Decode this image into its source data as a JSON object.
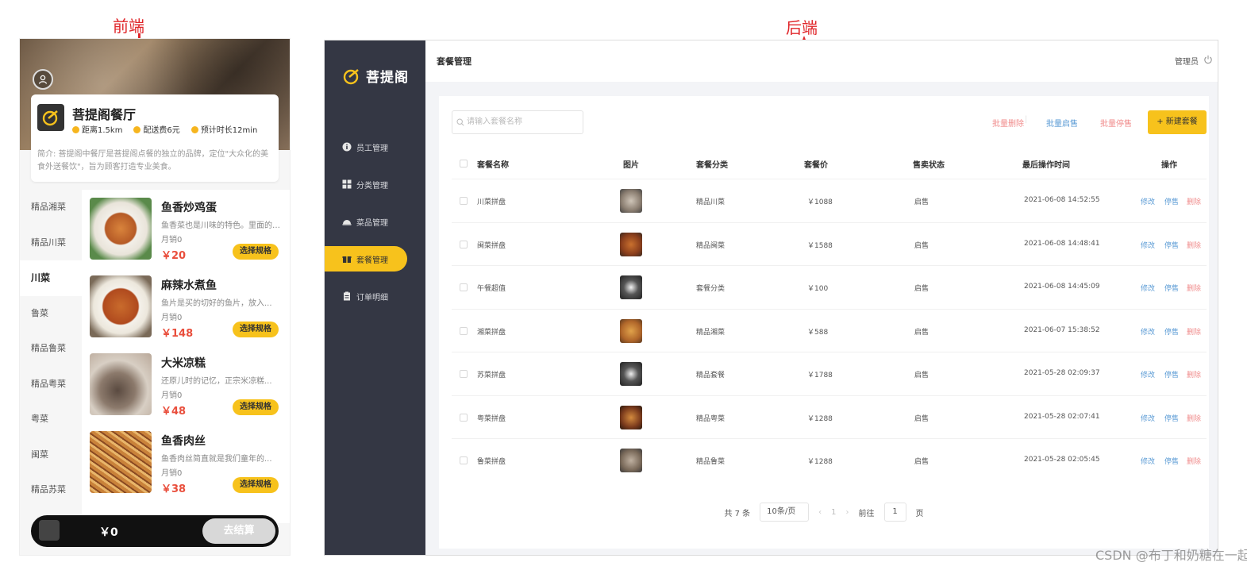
{
  "annotations": {
    "front": "前端",
    "back": "后端"
  },
  "mobile": {
    "shop_name": "菩提阁餐厅",
    "distance": "距离1.5km",
    "delivery_fee": "配送费6元",
    "eta": "预计时长12min",
    "intro": "简介: 菩提阁中餐厅是菩提阁点餐的独立的品牌，定位\"大众化的美食外送餐饮\"，旨为顾客打造专业美食。",
    "categories": [
      "精品湘菜",
      "精品川菜",
      "川菜",
      "鲁菜",
      "精品鲁菜",
      "精品粤菜",
      "粤菜",
      "闽菜",
      "精品苏菜"
    ],
    "active_category": "川菜",
    "dishes": [
      {
        "name": "鱼香炒鸡蛋",
        "desc": "鱼香菜也是川味的特色。里面的鸡蛋...",
        "sales": "月销0",
        "price": "￥20",
        "button": "选择规格"
      },
      {
        "name": "麻辣水煮鱼",
        "desc": "鱼片是买的切好的鱼片，放入...",
        "sales": "月销0",
        "price": "￥148",
        "button": "选择规格"
      },
      {
        "name": "大米凉糕",
        "desc": "还原儿时的记忆，正宗米凉糕...",
        "sales": "月销0",
        "price": "￥48",
        "button": "选择规格"
      },
      {
        "name": "鱼香肉丝",
        "desc": "鱼香肉丝简直就是我们童年的...",
        "sales": "月销0",
        "price": "￥38",
        "button": "选择规格"
      }
    ],
    "cart": {
      "price": "￥0",
      "checkout": "去结算"
    }
  },
  "admin": {
    "brand": "菩提阁",
    "nav": [
      {
        "label": "员工管理",
        "icon": "info-icon"
      },
      {
        "label": "分类管理",
        "icon": "grid-icon"
      },
      {
        "label": "菜品管理",
        "icon": "dish-cover-icon"
      },
      {
        "label": "套餐管理",
        "icon": "gift-icon"
      },
      {
        "label": "订单明细",
        "icon": "clipboard-icon"
      }
    ],
    "active_nav": "套餐管理",
    "page_title": "套餐管理",
    "user": "管理员",
    "search_placeholder": "请输入套餐名称",
    "batch_delete": "批量删除",
    "batch_enable": "批量启售",
    "batch_disable": "批量停售",
    "new_button": "+ 新建套餐",
    "columns": [
      "套餐名称",
      "图片",
      "套餐分类",
      "套餐价",
      "售卖状态",
      "最后操作时间",
      "操作"
    ],
    "rows": [
      {
        "name": "川菜拼盘",
        "category": "精品川菜",
        "price": "￥1088",
        "status": "启售",
        "time": "2021-06-08 14:52:55"
      },
      {
        "name": "闽菜拼盘",
        "category": "精品闽菜",
        "price": "￥1588",
        "status": "启售",
        "time": "2021-06-08 14:48:41"
      },
      {
        "name": "午餐超值",
        "category": "套餐分类",
        "price": "￥100",
        "status": "启售",
        "time": "2021-06-08 14:45:09"
      },
      {
        "name": "湘菜拼盘",
        "category": "精品湘菜",
        "price": "￥588",
        "status": "启售",
        "time": "2021-06-07 15:38:52"
      },
      {
        "name": "苏菜拼盘",
        "category": "精品套餐",
        "price": "￥1788",
        "status": "启售",
        "time": "2021-05-28 02:09:37"
      },
      {
        "name": "粤菜拼盘",
        "category": "精品粤菜",
        "price": "￥1288",
        "status": "启售",
        "time": "2021-05-28 02:07:41"
      },
      {
        "name": "鲁菜拼盘",
        "category": "精品鲁菜",
        "price": "￥1288",
        "status": "启售",
        "time": "2021-05-28 02:05:45"
      }
    ],
    "actions": {
      "edit": "修改",
      "disable": "停售",
      "delete": "删除"
    },
    "pager": {
      "total": "共 7 条",
      "page_size": "10条/页",
      "page": "1",
      "goto": "前往",
      "goto_value": "1",
      "page_unit": "页"
    }
  },
  "watermark": "CSDN @布丁和奶糖在一起",
  "colors": {
    "accent": "#f7c21c",
    "sidebar": "#343744",
    "price": "#e94e3c",
    "link_blue": "#5b9bd5",
    "link_red": "#f08b8b"
  }
}
